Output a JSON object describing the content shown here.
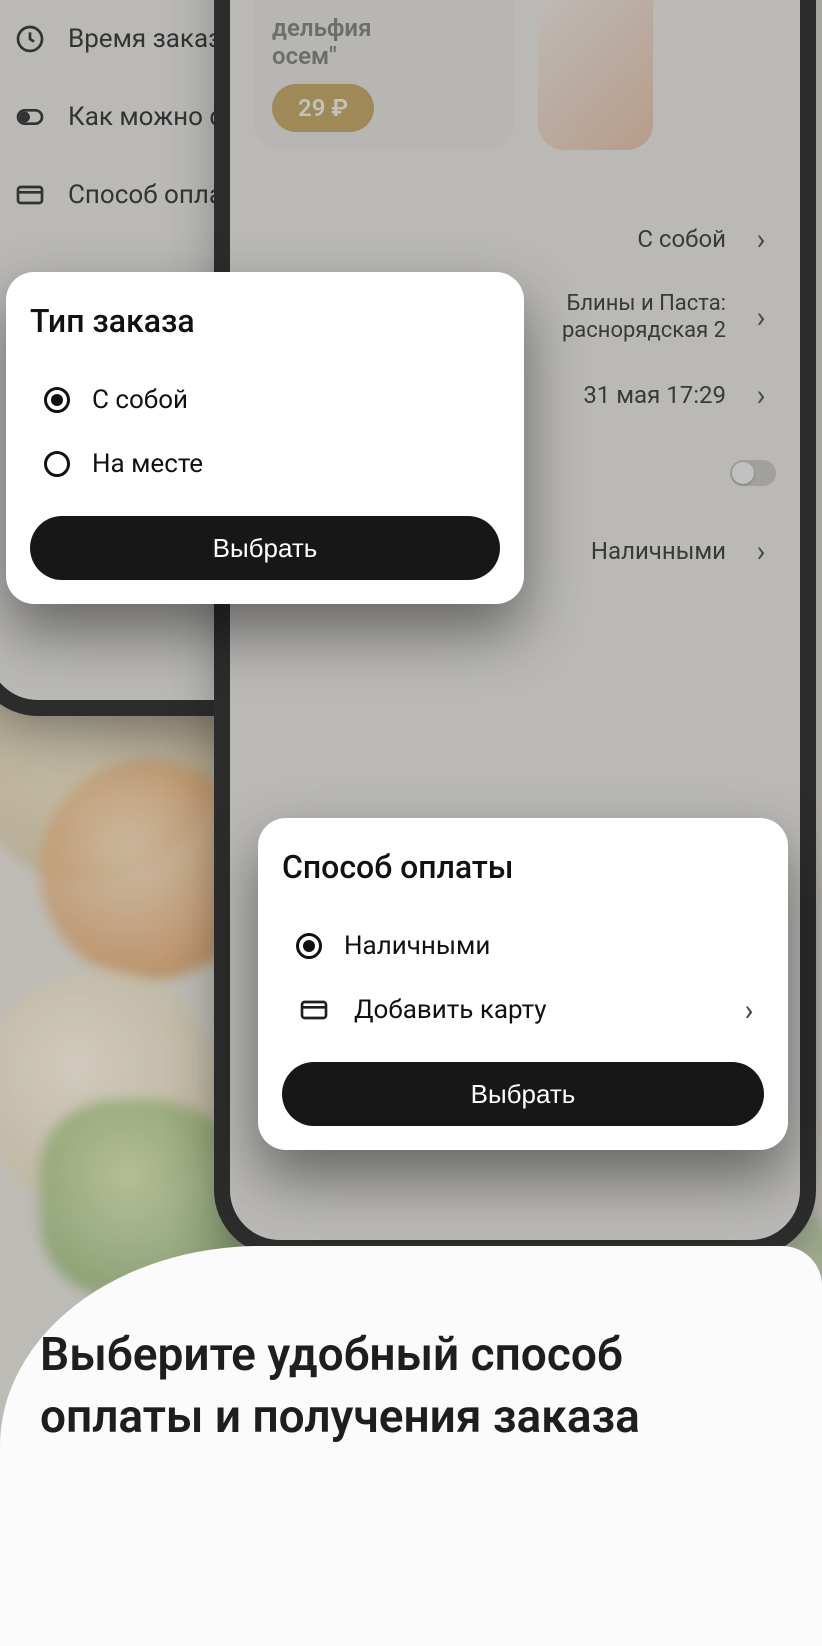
{
  "phoneA": {
    "rows": {
      "time_label": "Время заказа",
      "time_value": "31 мая 17:29",
      "asap_label": "Как можно скорее",
      "pay_label": "Способ оплаты",
      "pay_value": "Наличными"
    },
    "modal": {
      "title": "Тип заказа",
      "option1": "С собой",
      "option2": "На месте",
      "button": "Выбрать"
    }
  },
  "phoneB": {
    "product": {
      "title_line1": "дельфия",
      "title_line2": "осем\"",
      "price": "29 ₽"
    },
    "rows": {
      "type_value": "С собой",
      "addr_line1": "Блины и Паста:",
      "addr_line2": "раснорядская 2",
      "time_value": "31 мая 17:29",
      "pay_label": "Способ оплаты",
      "pay_value": "Наличными"
    },
    "modal": {
      "title": "Способ оплаты",
      "option1": "Наличными",
      "option2": "Добавить карту",
      "button": "Выбрать"
    }
  },
  "marketing": {
    "headline": "Выберите удобный способ оплаты и получения заказа"
  }
}
